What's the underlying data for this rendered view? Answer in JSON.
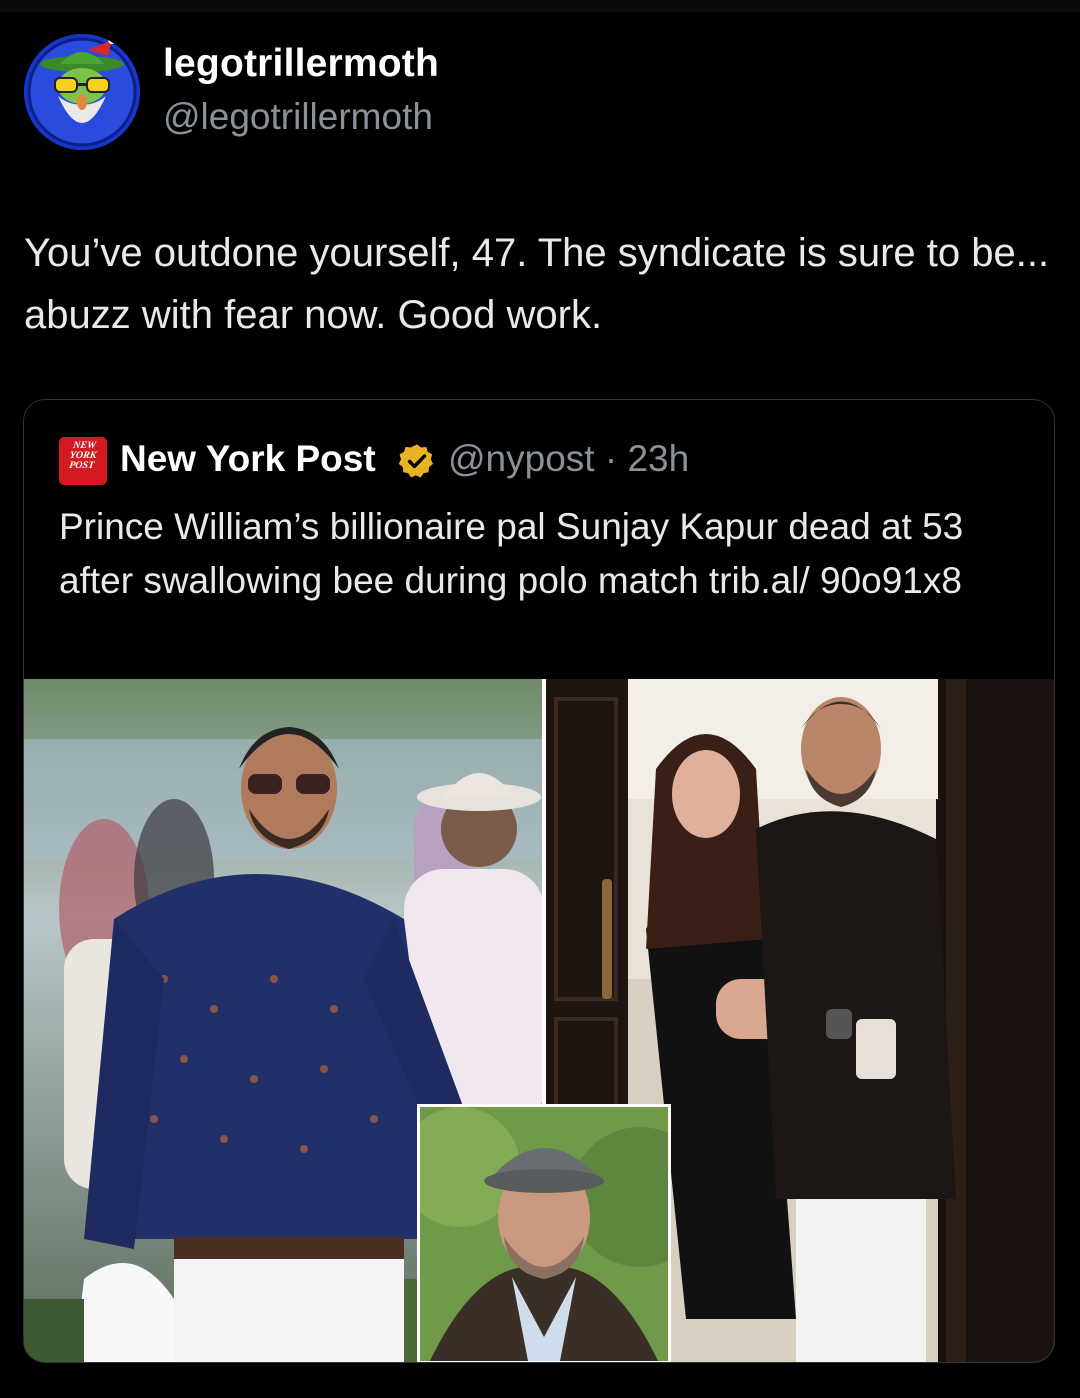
{
  "author": {
    "display_name": "legotrillermoth",
    "handle": "@legotrillermoth",
    "avatar_icon": "wizard-alien-avatar"
  },
  "tweet": {
    "text": "You’ve outdone yourself, 47. The syndicate is sure to be... abuzz with fear now. Good work."
  },
  "quoted_post": {
    "logo_text": "NEW\nYORK\nPOST",
    "name": "New York Post",
    "verified_icon": "verified-badge-icon",
    "handle": "@nypost",
    "separator": "·",
    "time": "23h",
    "meta": "@nypost · 23h",
    "text": "Prince William’s billionaire pal Sunjay Kapur dead at 53 after swallowing bee during polo match trib.al/ 90o91x8"
  },
  "colors": {
    "background": "#000000",
    "text": "#e7e9ea",
    "muted": "#8b9199",
    "card_border": "#2f3336",
    "nypost_red": "#d31a21",
    "verified_gold": "#e8b323"
  }
}
